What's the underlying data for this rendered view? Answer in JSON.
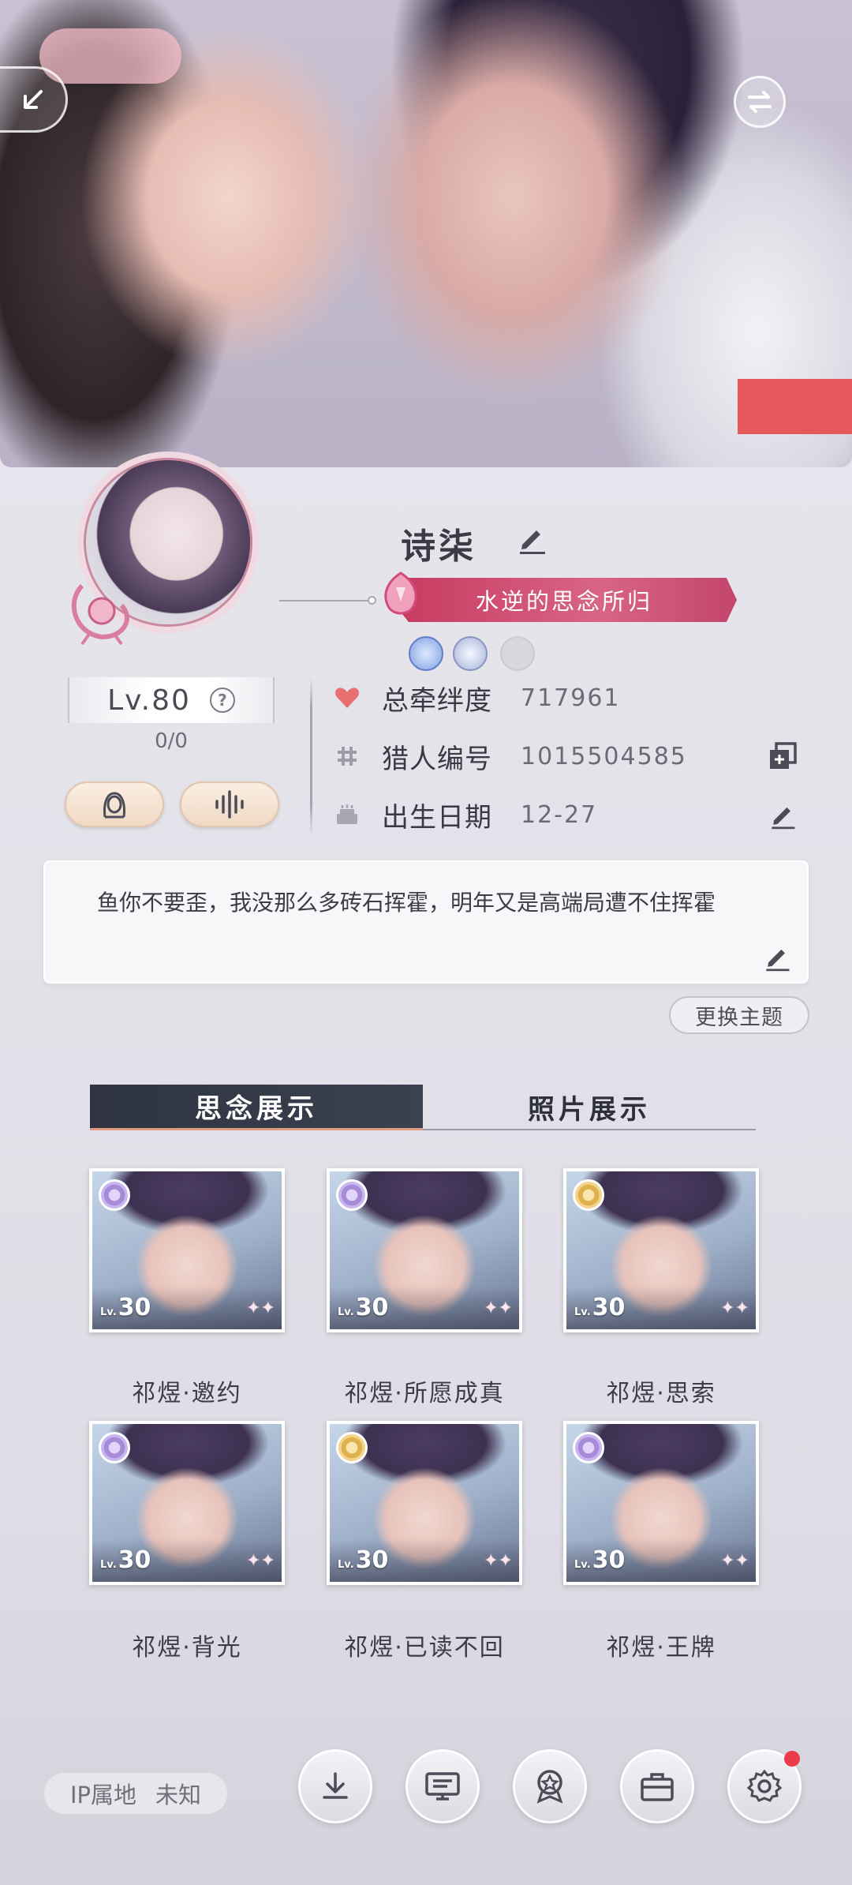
{
  "profile": {
    "name": "诗柒",
    "title": "水逆的思念所归",
    "level": "Lv.80",
    "level_help": "?",
    "level_progress": "0/0"
  },
  "info": {
    "bond_label": "总牵绊度",
    "bond_value": "717961",
    "hunter_id_label": "猎人编号",
    "hunter_id_value": "1015504585",
    "birthday_label": "出生日期",
    "birthday_value": "12-27"
  },
  "signature": "鱼你不要歪，我没那么多砖石挥霍，明年又是高端局遭不住挥霍",
  "theme_button": "更换主题",
  "tabs": [
    "思念展示",
    "照片展示"
  ],
  "cards": [
    {
      "name": "祁煜·邀约",
      "level": "30",
      "lv_prefix": "Lv.",
      "rank": "purple"
    },
    {
      "name": "祁煜·所愿成真",
      "level": "30",
      "lv_prefix": "Lv.",
      "rank": "purple"
    },
    {
      "name": "祁煜·思索",
      "level": "30",
      "lv_prefix": "Lv.",
      "rank": "gold"
    },
    {
      "name": "祁煜·背光",
      "level": "30",
      "lv_prefix": "Lv.",
      "rank": "purple"
    },
    {
      "name": "祁煜·已读不回",
      "level": "30",
      "lv_prefix": "Lv.",
      "rank": "gold"
    },
    {
      "name": "祁煜·王牌",
      "level": "30",
      "lv_prefix": "Lv.",
      "rank": "purple"
    }
  ],
  "ip": {
    "label": "IP属地",
    "value": "未知"
  },
  "icons": {
    "back": "back-arrow-icon",
    "swap": "swap-icon",
    "edit": "pencil-icon",
    "heart": "heart-icon",
    "hash": "hash-icon",
    "cake": "cake-icon",
    "copy": "copy-icon",
    "download": "download-icon",
    "board": "message-board-icon",
    "badge": "achievement-badge-icon",
    "briefcase": "briefcase-icon",
    "settings": "gear-icon"
  },
  "colors": {
    "accent_pink": "#d0456e",
    "heart": "#e8706f",
    "tab_active_bg": "#343946",
    "notification": "#ec3b4a"
  }
}
